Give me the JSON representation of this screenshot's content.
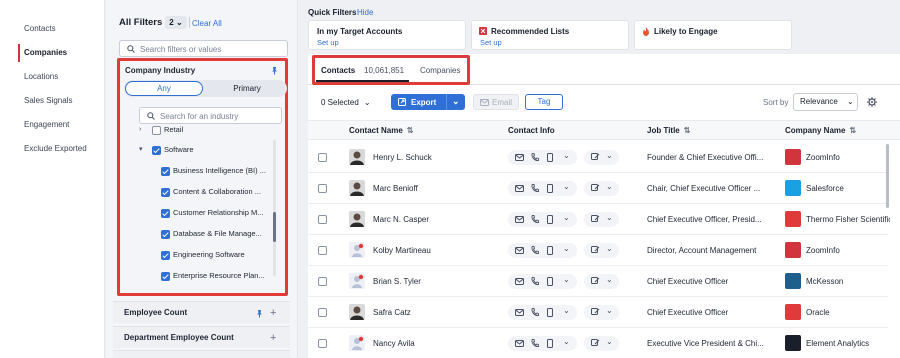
{
  "left_nav": {
    "items": [
      {
        "label": "Contacts",
        "active": false
      },
      {
        "label": "Companies",
        "active": true
      },
      {
        "label": "Locations",
        "active": false
      },
      {
        "label": "Sales Signals",
        "active": false
      },
      {
        "label": "Engagement",
        "active": false
      },
      {
        "label": "Exclude Exported",
        "active": false
      }
    ]
  },
  "filters": {
    "title": "All Filters",
    "count": "2",
    "clear_label": "Clear All",
    "search_placeholder": "Search filters or values",
    "company_industry": {
      "title": "Company Industry",
      "seg_any": "Any",
      "seg_primary": "Primary",
      "search_placeholder": "Search for an industry",
      "items": [
        {
          "label": "Retail",
          "checked": false,
          "level": 1,
          "expand": "right"
        },
        {
          "label": "Software",
          "checked": true,
          "level": 0,
          "expand": "down"
        },
        {
          "label": "Business Intelligence (BI) ...",
          "checked": true,
          "level": 2
        },
        {
          "label": "Content & Collaboration ...",
          "checked": true,
          "level": 2
        },
        {
          "label": "Customer Relationship M...",
          "checked": true,
          "level": 2
        },
        {
          "label": "Database & File Manage...",
          "checked": true,
          "level": 2
        },
        {
          "label": "Engineering Software",
          "checked": true,
          "level": 2
        },
        {
          "label": "Enterprise Resource Plan...",
          "checked": true,
          "level": 2
        }
      ]
    },
    "sections": [
      {
        "label": "Employee Count",
        "pinned": true
      },
      {
        "label": "Department Employee Count",
        "pinned": false
      }
    ]
  },
  "quick_filters": {
    "label": "Quick Filters",
    "hide_label": "Hide",
    "cards": [
      {
        "title": "In my Target Accounts",
        "sub": "Set up",
        "icon": "none"
      },
      {
        "title": "Recommended Lists",
        "sub": "Set up",
        "icon": "list-icon"
      },
      {
        "title": "Likely to Engage",
        "sub": "",
        "icon": "flame-icon"
      }
    ]
  },
  "tabs": {
    "contacts": "Contacts",
    "count": "10,061,851",
    "companies": "Companies"
  },
  "toolbar": {
    "selected": "0 Selected",
    "export": "Export",
    "email": "Email",
    "tag": "Tag",
    "sort_label": "Sort by",
    "sort_value": "Relevance"
  },
  "table": {
    "headers": [
      "Contact Name",
      "Contact Info",
      "Job Title",
      "Company Name"
    ],
    "rows": [
      {
        "name": "Henry L. Schuck",
        "job": "Founder & Chief Executive Offi...",
        "company": "ZoomInfo",
        "logo_color": "#d0343c",
        "photo": true
      },
      {
        "name": "Marc Benioff",
        "job": "Chair, Chief Executive Officer ...",
        "company": "Salesforce",
        "logo_color": "#1ba1e2",
        "photo": true
      },
      {
        "name": "Marc N. Casper",
        "job": "Chief Executive Officer, Presid...",
        "company": "Thermo Fisher Scientific",
        "logo_color": "#e03b3b",
        "photo": true
      },
      {
        "name": "Kolby Martineau",
        "job": "Director, Account Management",
        "company": "ZoomInfo",
        "logo_color": "#d0343c",
        "photo": false
      },
      {
        "name": "Brian S. Tyler",
        "job": "Chief Executive Officer",
        "company": "McKesson",
        "logo_color": "#1f5f8b",
        "photo": false
      },
      {
        "name": "Safra Catz",
        "job": "Chief Executive Officer",
        "company": "Oracle",
        "logo_color": "#e03b3b",
        "photo": true
      },
      {
        "name": "Nancy Avila",
        "job": "Executive Vice President & Chi...",
        "company": "Element Analytics",
        "logo_color": "#1a1f2c",
        "photo": false
      }
    ]
  },
  "colors": {
    "accent": "#2f6fd6",
    "highlight": "#e03b3b"
  }
}
